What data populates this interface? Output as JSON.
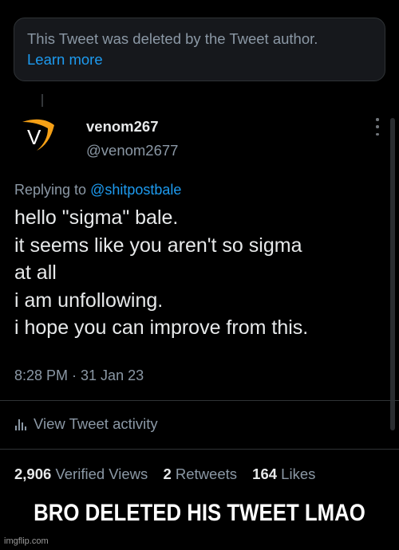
{
  "deleted_notice": {
    "text": "This Tweet was deleted by the Tweet author.",
    "link": "Learn more"
  },
  "author": {
    "display_name": "venom267",
    "handle": "@venom2677",
    "avatar_letter": "V"
  },
  "tweet": {
    "replying_prefix": "Replying to",
    "replying_to": "@shitpostbale",
    "lines": [
      "hello \"sigma\" bale.",
      "it seems like you aren't so sigma",
      "at all",
      "i am unfollowing.",
      "i hope you can improve from this."
    ],
    "timestamp": "8:28 PM · 31 Jan 23"
  },
  "activity": {
    "label": "View Tweet activity"
  },
  "stats": {
    "views": {
      "count": "2,906",
      "label": "Verified Views"
    },
    "retweets": {
      "count": "2",
      "label": "Retweets"
    },
    "likes": {
      "count": "164",
      "label": "Likes"
    }
  },
  "caption": "BRO DELETED HIS TWEET LMAO",
  "watermark": "imgflip.com",
  "colors": {
    "background": "#000000",
    "link_blue": "#1d9bf0",
    "secondary_text": "#8b98a5",
    "avatar_orange": "#f5a016"
  }
}
